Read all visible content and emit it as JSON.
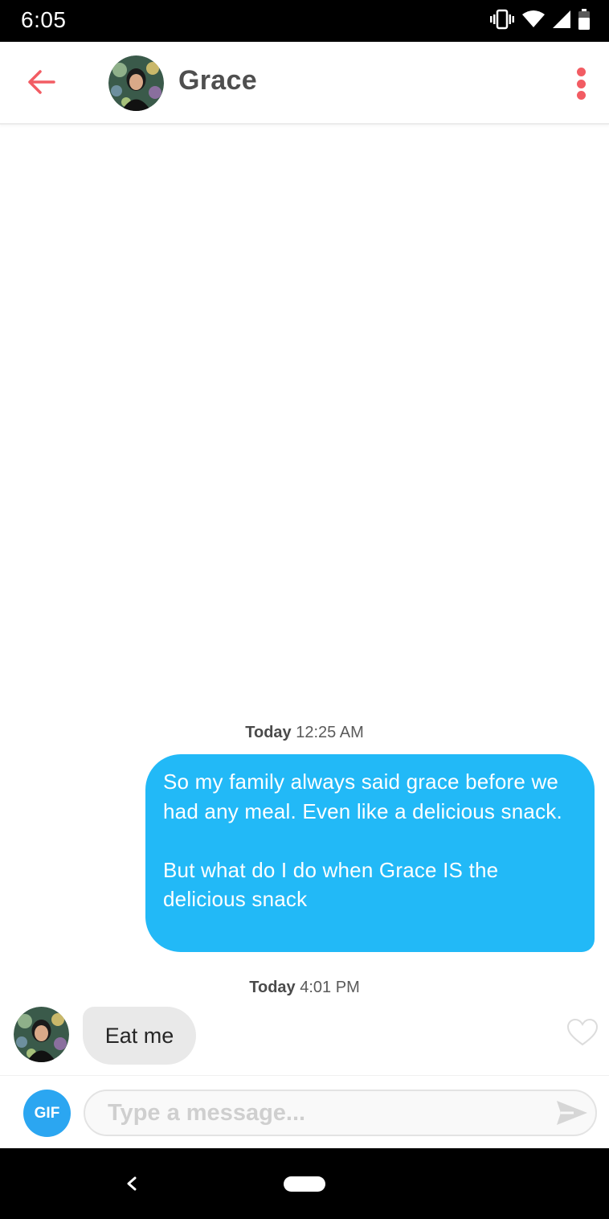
{
  "status_bar": {
    "time": "6:05",
    "icons": [
      "vibrate-icon",
      "wifi-icon",
      "signal-icon",
      "battery-icon"
    ]
  },
  "header": {
    "back_icon": "arrow-left-icon",
    "contact_name": "Grace",
    "avatar": "profile-photo",
    "menu_icon": "more-vertical-icon"
  },
  "conversation": {
    "groups": [
      {
        "timestamp_day": "Today",
        "timestamp_time": "12:25 AM",
        "message": {
          "direction": "sent",
          "paragraph_1": "So my family always said grace before we had any meal. Even like a delicious snack.",
          "paragraph_2": "But what do I do when Grace IS the delicious snack"
        }
      },
      {
        "timestamp_day": "Today",
        "timestamp_time": "4:01 PM",
        "message": {
          "direction": "received",
          "text": "Eat me"
        }
      }
    ]
  },
  "composer": {
    "gif_label": "GIF",
    "placeholder": "Type a message...",
    "send_icon": "send-icon"
  },
  "nav_bar": {
    "icons": [
      "nav-back-icon",
      "nav-home-pill"
    ]
  },
  "colors": {
    "accent": "#f25c63",
    "sent_bubble": "#22b9f7",
    "received_bubble": "#e9e9e9",
    "gif_button": "#2ba6f1"
  }
}
